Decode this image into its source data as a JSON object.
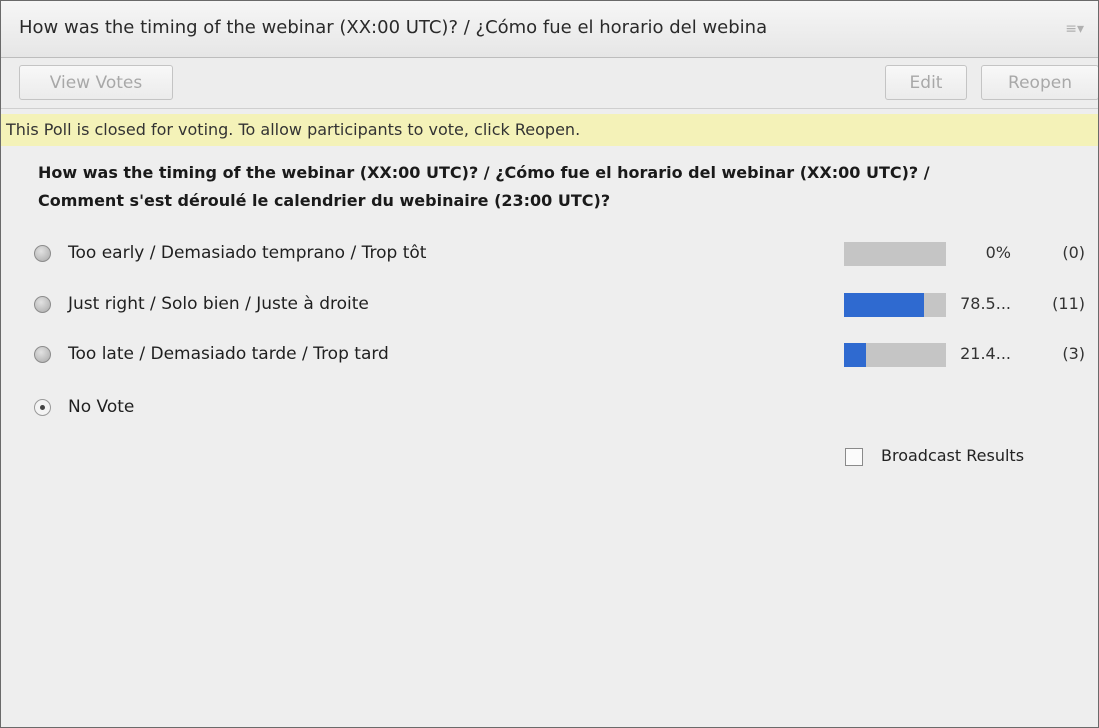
{
  "pod": {
    "title": "How was the timing of the webinar (XX:00 UTC)? / ¿Cómo fue el horario del webina",
    "menu_icon": "≡▾"
  },
  "toolbar": {
    "view_votes_label": "View Votes",
    "edit_label": "Edit",
    "reopen_label": "Reopen"
  },
  "notice": "This Poll is closed for voting. To allow participants to vote, click Reopen.",
  "question_lines": [
    "How was the timing of the webinar (XX:00 UTC)? / ¿Cómo fue el horario del webinar (XX:00 UTC)? /",
    "Comment s'est déroulé le calendrier du webinaire (23:00 UTC)?"
  ],
  "options": [
    {
      "label": "Too early / Demasiado temprano / Trop tôt",
      "percent_text": "0%",
      "count_text": "(0)",
      "fraction": 0.0
    },
    {
      "label": "Just right / Solo bien / Juste à droite",
      "percent_text": "78.5...",
      "count_text": "(11)",
      "fraction": 0.785
    },
    {
      "label": "Too late / Demasiado tarde / Trop tard",
      "percent_text": "21.4...",
      "count_text": "(3)",
      "fraction": 0.214
    },
    {
      "label": "No Vote",
      "selected": true
    }
  ],
  "broadcast": {
    "label": "Broadcast Results",
    "checked": false
  },
  "colors": {
    "bar_fill": "#2f6ad0",
    "bar_track": "#c5c5c5",
    "notice_bg": "#f4f2b8"
  }
}
